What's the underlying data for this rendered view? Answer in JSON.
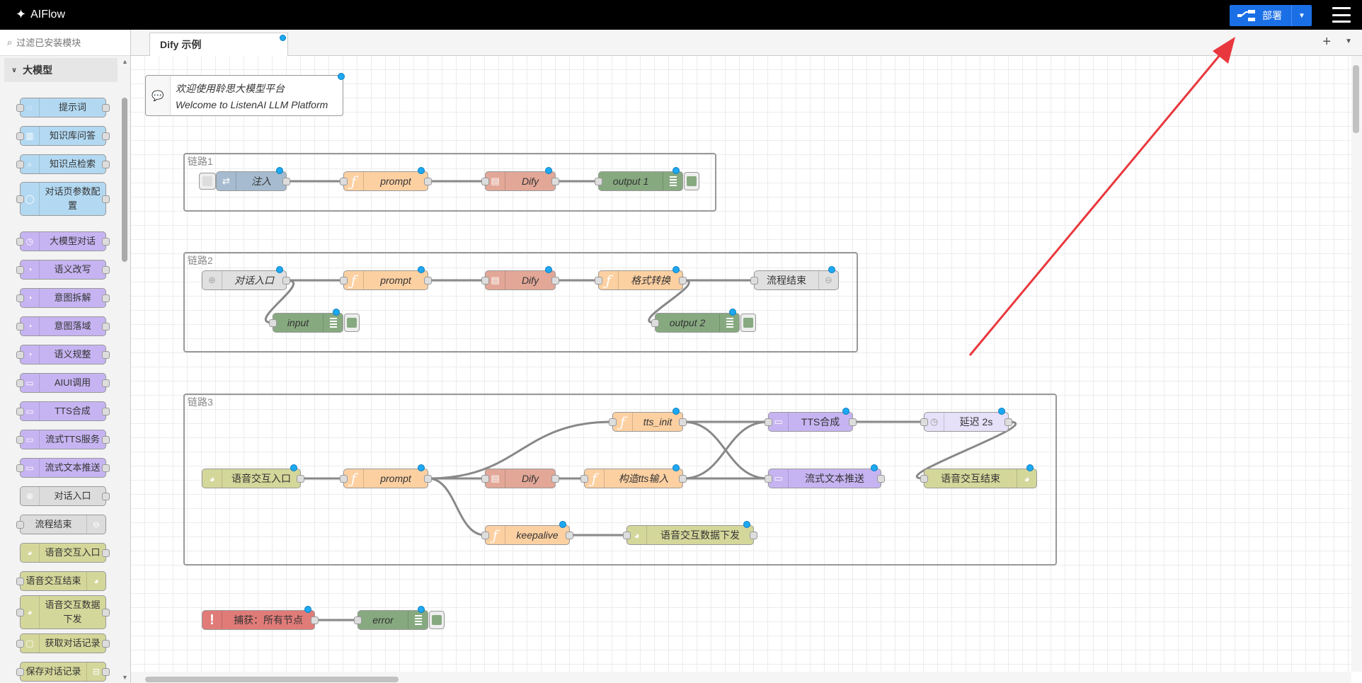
{
  "header": {
    "app_name": "AIFlow",
    "deploy_label": "部署"
  },
  "palette": {
    "filter_placeholder": "过滤已安装模块",
    "category": "大模型",
    "items": [
      {
        "label": "提示词",
        "color": "#b3d9f2",
        "icon": "lightbulb-icon"
      },
      {
        "label": "知识库问答",
        "color": "#b3d9f2",
        "icon": "book-icon"
      },
      {
        "label": "知识点检索",
        "color": "#b3d9f2",
        "icon": "search-icon"
      },
      {
        "label": "对话页参数配置",
        "color": "#b3d9f2",
        "icon": "user-icon"
      },
      {
        "label": "大模型对话",
        "color": "#c6b4f2",
        "icon": "timer-icon"
      },
      {
        "label": "语义改写",
        "color": "#c6b4f2",
        "icon": "ai-icon"
      },
      {
        "label": "意图拆解",
        "color": "#c6b4f2",
        "icon": "ai-icon"
      },
      {
        "label": "意图落域",
        "color": "#c6b4f2",
        "icon": "ai-icon"
      },
      {
        "label": "语义规整",
        "color": "#c6b4f2",
        "icon": "ai-icon"
      },
      {
        "label": "AIUI调用",
        "color": "#c6b4f2",
        "icon": "aiui-icon"
      },
      {
        "label": "TTS合成",
        "color": "#c6b4f2",
        "icon": "aiui-icon"
      },
      {
        "label": "流式TTS服务",
        "color": "#c6b4f2",
        "icon": "aiui-icon"
      },
      {
        "label": "流式文本推送",
        "color": "#c6b4f2",
        "icon": "aiui-icon"
      },
      {
        "label": "对话入口",
        "color": "#dcdcdc",
        "icon": "enter-icon"
      },
      {
        "label": "流程结束",
        "color": "#dcdcdc",
        "icon": "exit-icon"
      },
      {
        "label": "语音交互入口",
        "color": "#d4d79a",
        "icon": "globe-icon"
      },
      {
        "label": "语音交互结束",
        "color": "#d4d79a",
        "icon": "globe-icon"
      },
      {
        "label": "语音交互数据下发",
        "color": "#d4d79a",
        "icon": "globe-icon"
      },
      {
        "label": "获取对话记录",
        "color": "#d4d79a",
        "icon": "chat-icon"
      },
      {
        "label": "保存对话记录",
        "color": "#d4d79a",
        "icon": "save-icon"
      }
    ]
  },
  "tabs": {
    "main": "Dify 示例"
  },
  "flow": {
    "comment": {
      "line1": "欢迎使用聆思大模型平台",
      "line2": "Welcome to ListenAI LLM Platform"
    },
    "groups": {
      "g1": "链路1",
      "g2": "链路2",
      "g3": "链路3"
    },
    "nodes": {
      "inject": "注入",
      "prompt1": "prompt",
      "dify1": "Dify",
      "output1": "output 1",
      "entry2": "对话入口",
      "prompt2": "prompt",
      "dify2": "Dify",
      "convert": "格式转换",
      "end2": "流程结束",
      "input": "input",
      "output2": "output 2",
      "ventry": "语音交互入口",
      "prompt3": "prompt",
      "dify3": "Dify",
      "ttsinit": "tts_init",
      "buildtts": "构造tts输入",
      "keepalive": "keepalive",
      "tts": "TTS合成",
      "stream": "流式文本推送",
      "delay": "延迟 2s",
      "vend": "语音交互结束",
      "vdata": "语音交互数据下发",
      "catch": "捕获：所有节点",
      "error": "error"
    }
  },
  "colors": {
    "function": "#fdd0a2",
    "dify": "#e2a797",
    "debug": "#87a980",
    "inject": "#a6bbcf",
    "gray": "#e0e0e0",
    "voice": "#d4d79a",
    "aiui": "#c6b4f2",
    "catch": "#e07b78",
    "delay": "#e6e0f8"
  }
}
